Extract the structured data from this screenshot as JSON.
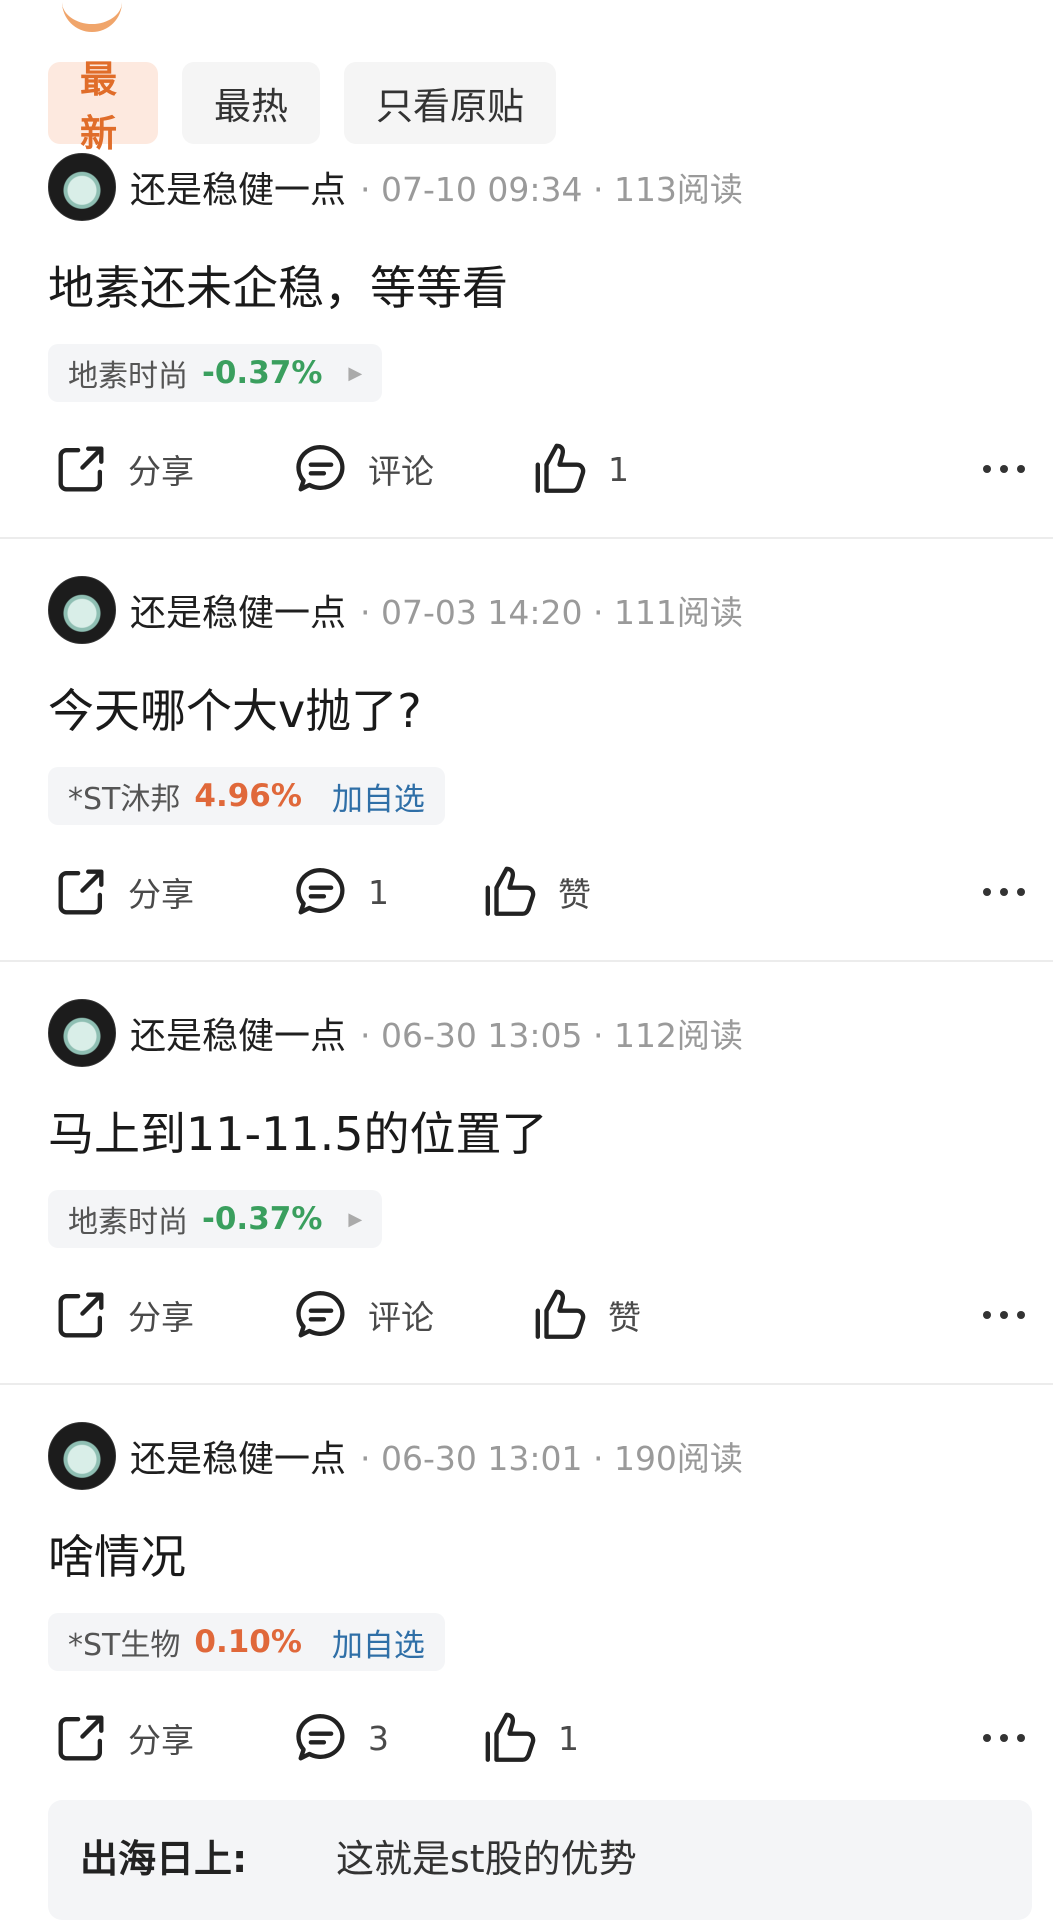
{
  "tabs": [
    {
      "label": "最新",
      "active": true
    },
    {
      "label": "最热",
      "active": false
    },
    {
      "label": "只看原贴",
      "active": false
    }
  ],
  "posts": [
    {
      "author": "还是稳健一点",
      "meta": "· 07-10 09:34 · 113阅读",
      "text": "地素还未企稳，等等看",
      "stock": {
        "name": "地素时尚",
        "pct": "-0.37%",
        "direction": "down",
        "add_label": ""
      },
      "share_label": "分享",
      "comment_label": "评论",
      "like_label": "1"
    },
    {
      "author": "还是稳健一点",
      "meta": "· 07-03 14:20 · 111阅读",
      "text": "今天哪个大v抛了?",
      "stock": {
        "name": "*ST沐邦",
        "pct": "4.96%",
        "direction": "up",
        "add_label": "加自选"
      },
      "share_label": "分享",
      "comment_label": "1",
      "like_label": "赞"
    },
    {
      "author": "还是稳健一点",
      "meta": "· 06-30 13:05 · 112阅读",
      "text": "马上到11-11.5的位置了",
      "stock": {
        "name": "地素时尚",
        "pct": "-0.37%",
        "direction": "down",
        "add_label": ""
      },
      "share_label": "分享",
      "comment_label": "评论",
      "like_label": "赞"
    },
    {
      "author": "还是稳健一点",
      "meta": "· 06-30 13:01 · 190阅读",
      "text": "啥情况",
      "stock": {
        "name": "*ST生物",
        "pct": "0.10%",
        "direction": "up",
        "add_label": "加自选"
      },
      "share_label": "分享",
      "comment_label": "3",
      "like_label": "1"
    }
  ],
  "comment_preview": {
    "author": "出海日上:",
    "text": "这就是st股的优势"
  },
  "colors": {
    "accent": "#e06d2a",
    "down": "#3a9f5e",
    "link": "#2f6fa7"
  }
}
